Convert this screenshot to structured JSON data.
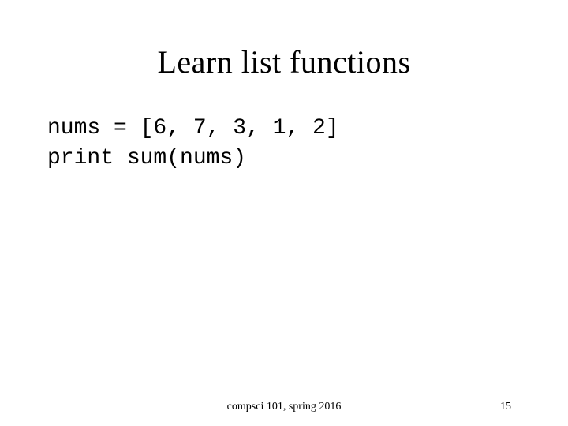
{
  "title": "Learn list functions",
  "code": {
    "line1": "nums = [6, 7, 3, 1, 2]",
    "line2": "print sum(nums)"
  },
  "footer": {
    "center": "compsci 101, spring 2016",
    "page": "15"
  }
}
